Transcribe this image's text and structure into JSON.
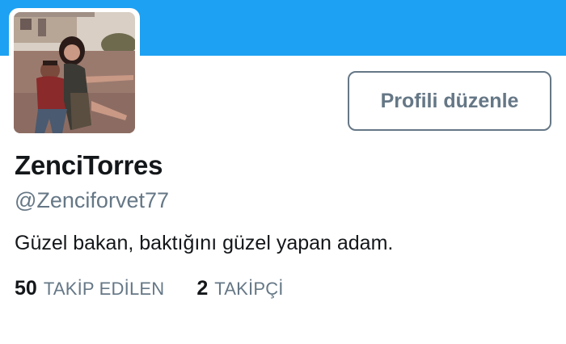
{
  "profile": {
    "display_name": "ZenciTorres",
    "handle": "@Zenciforvet77",
    "bio": "Güzel bakan, baktığını güzel yapan adam.",
    "edit_button_label": "Profili düzenle",
    "avatar_alt": "profile photo"
  },
  "stats": {
    "following_count": "50",
    "following_label": "TAKİP EDİLEN",
    "followers_count": "2",
    "followers_label": "TAKİPÇİ"
  },
  "colors": {
    "banner": "#1da1f2",
    "primary_text": "#14171a",
    "secondary_text": "#657786"
  }
}
